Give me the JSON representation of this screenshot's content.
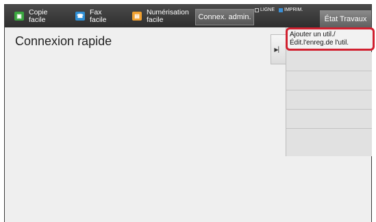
{
  "topbar": {
    "apps": [
      {
        "line1": "Copie",
        "line2": "facile",
        "icon": "copy-icon",
        "color": "#3aa63f"
      },
      {
        "line1": "Fax",
        "line2": "facile",
        "icon": "fax-icon",
        "color": "#2f8fd6"
      },
      {
        "line1": "Numérisation",
        "line2": "facile",
        "icon": "scan-icon",
        "color": "#f0a030"
      }
    ],
    "admin_label": "Connex. admin.",
    "status": {
      "line_label": "LIGNE",
      "print_label": "IMPRIM.",
      "print_color": "#3a8fd6"
    },
    "jobs_label": "État Travaux"
  },
  "page": {
    "title": "Connexion rapide"
  },
  "panel": {
    "items": [
      {
        "line1": "Ajouter un util./",
        "line2": "Édit.l'enreg.de l'util."
      }
    ]
  },
  "colors": {
    "highlight": "#d1202f",
    "topbar": "#3a3a3a"
  }
}
